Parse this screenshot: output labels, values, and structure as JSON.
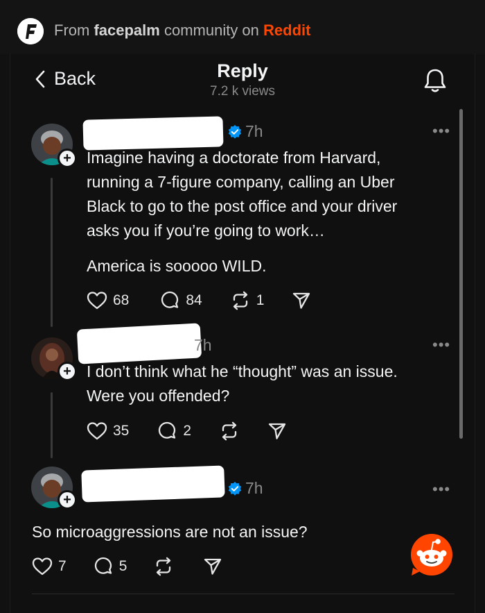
{
  "banner": {
    "prefix": "From ",
    "community": "facepalm",
    "middle": " community on ",
    "platform": "Reddit"
  },
  "header": {
    "back_label": "Back",
    "title": "Reply",
    "views": "7.2 k views"
  },
  "posts": [
    {
      "time": "7h",
      "verified": true,
      "lines": [
        "Imagine having a doctorate from Harvard,",
        "running a 7-figure company, calling an Uber",
        "Black to go to the post office and your driver",
        "asks you if you’re going to work…"
      ],
      "extra": "America is sooooo WILD.",
      "likes": "68",
      "comments": "84",
      "reposts": "1"
    },
    {
      "time": "7h",
      "verified": false,
      "lines": [
        "I don’t think what he “thought” was an issue.",
        "Were you offended?"
      ],
      "likes": "35",
      "comments": "2",
      "reposts": ""
    },
    {
      "time": "7h",
      "verified": true,
      "lines": [
        "So microaggressions are not an issue?"
      ],
      "likes": "7",
      "comments": "5",
      "reposts": ""
    }
  ],
  "colors": {
    "accent_reddit": "#ff4500",
    "verified_blue": "#0095f6",
    "background": "#101010"
  }
}
